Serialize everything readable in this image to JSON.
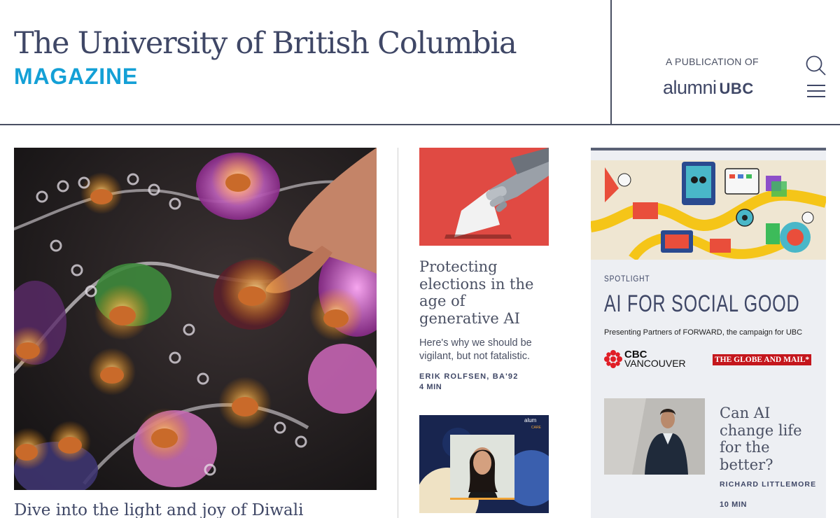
{
  "header": {
    "title": "The University of British Columbia",
    "subtitle": "MAGAZINE",
    "publication_of": "A PUBLICATION OF",
    "alumni_word": "alumni",
    "alumni_ubc": "UBC",
    "search_icon": "search-icon",
    "menu_icon": "hamburger-menu-icon"
  },
  "hero": {
    "title": "Dive into the light and joy of Diwali"
  },
  "article1": {
    "title": "Protecting elections in the age of generative AI",
    "description": "Here's why we should be vigilant, but not fatalistic.",
    "author": "ERIK ROLFSEN, BA'92",
    "read_time": "4 MIN"
  },
  "article2": {
    "logo_text": "alum",
    "logo_sub": "CARE"
  },
  "spotlight": {
    "kicker": "SPOTLIGHT",
    "title": "AI FOR SOCIAL GOOD",
    "partners": "Presenting Partners of FORWARD, the campaign for UBC",
    "cbc_line1": "CBC",
    "cbc_line2": "VANCOUVER",
    "globe": "THE GLOBE AND MAIL*",
    "article_title": "Can AI change life for the better?",
    "author": "RICHARD LITTLEMORE",
    "read_time": "10 MIN"
  },
  "colors": {
    "navy": "#3f4766",
    "accent_blue": "#14a0d6",
    "spotlight_bg": "#edeff3",
    "red": "#e04a43",
    "globe_red": "#c4161c"
  }
}
